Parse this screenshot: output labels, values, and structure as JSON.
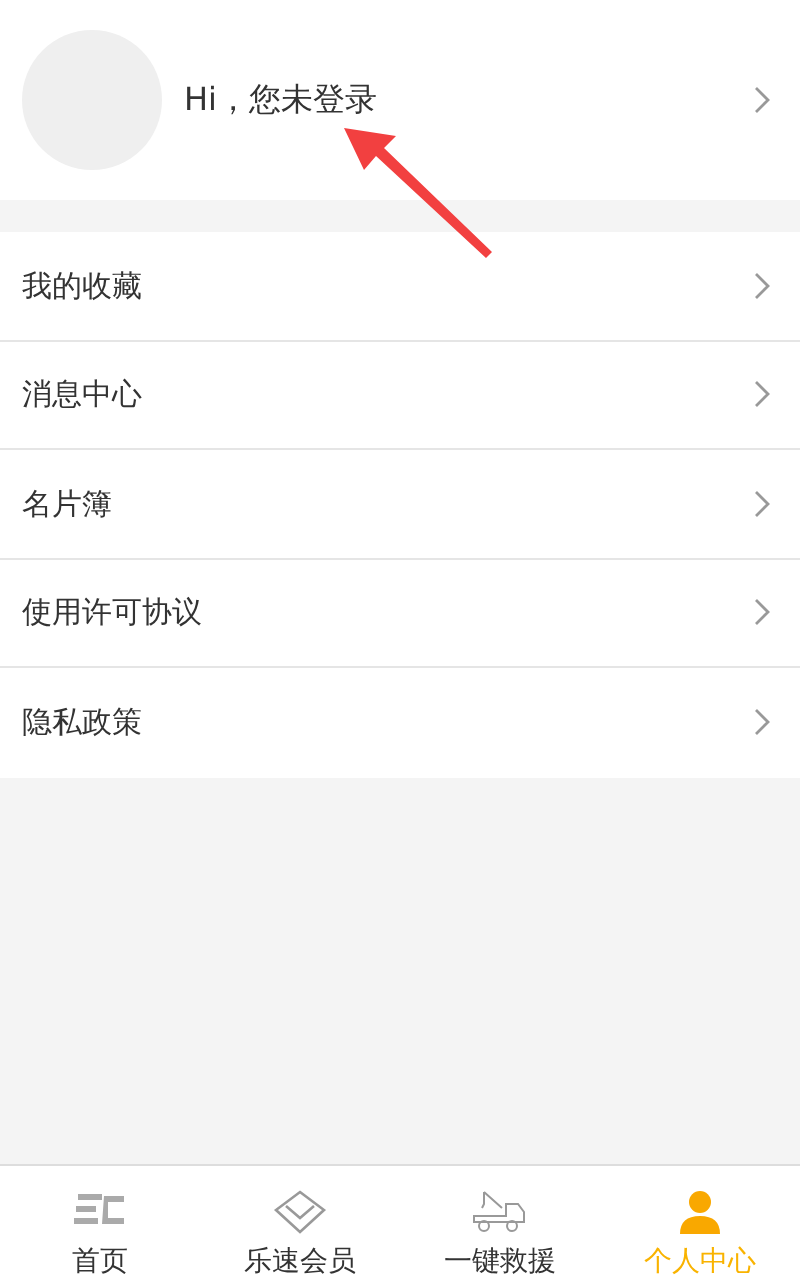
{
  "profile": {
    "greeting": "Hi，您未登录"
  },
  "menu": [
    {
      "label": "我的收藏"
    },
    {
      "label": "消息中心"
    },
    {
      "label": "名片簿"
    },
    {
      "label": "使用许可协议"
    },
    {
      "label": "隐私政策"
    }
  ],
  "tab_bar": [
    {
      "label": "首页",
      "selected": false
    },
    {
      "label": "乐速会员",
      "selected": false
    },
    {
      "label": "一键救援",
      "selected": false
    },
    {
      "label": "个人中心",
      "selected": true
    }
  ]
}
